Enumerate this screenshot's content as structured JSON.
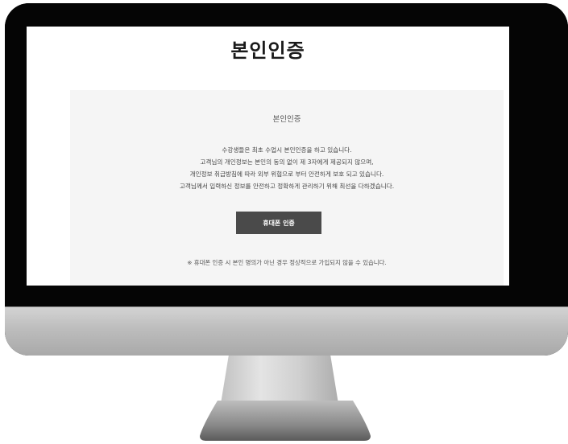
{
  "page": {
    "title": "본인인증"
  },
  "panel": {
    "title": "본인인증",
    "description_lines": [
      "수강생들은 최초 수업시 본인인증을 하고 있습니다.",
      "고객님의 개인정보는 본인의 동의 없이 제 3자에게 제공되지 않으며,",
      "개인정보 취급방침에 따라 외부 위협으로 부터 안전하게 보호 되고 있습니다.",
      "고객님께서 입력하신 정보를 안전하고 정확하게 관리하기 위해 최선을 다하겠습니다."
    ],
    "button_label": "휴대폰 인증",
    "notice": "※ 휴대폰 인증 시 본인 명의가 아닌 경우 정상적으로 가입되지 않을 수 있습니다."
  },
  "colors": {
    "bezel": "#050505",
    "chin": "#c0c0c0",
    "panel_bg": "#f5f5f5",
    "button_bg": "#4a4a4a"
  }
}
